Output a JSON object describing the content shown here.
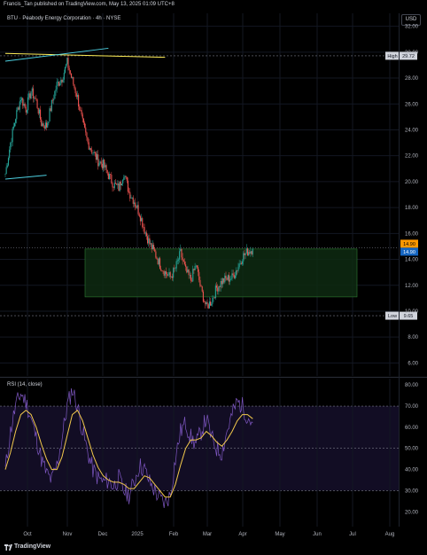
{
  "header": {
    "publisher_text": "Francis_Tan published on TradingView.com, May 13, 2025 01:09 UTC+8"
  },
  "footer": {
    "brand": "TradingView"
  },
  "currency_label": "USD",
  "colors": {
    "background": "#000000",
    "candle_up": "#26a69a",
    "candle_down": "#ef5350",
    "rsi_line": "#7e57c2",
    "rsi_ma": "#f2c94c",
    "cyan_line": "#4dd0e1",
    "yellow_line": "#ffee58",
    "zone_fill": "#0e2a12",
    "zone_border": "#2e7d32",
    "last_price_label": "#ff9800"
  },
  "chart_data": [
    {
      "type": "candlestick",
      "title": "BTU · Peabody Energy Corporation · 4h · NYSE",
      "x_ticks": [
        "Oct",
        "Nov",
        "Dec",
        "2025",
        "Feb",
        "Mar",
        "Apr",
        "May",
        "Jun",
        "Jul",
        "Aug"
      ],
      "y_ticks": [
        "6.00",
        "8.00",
        "10.00",
        "12.00",
        "14.00",
        "16.00",
        "18.00",
        "20.00",
        "22.00",
        "24.00",
        "26.00",
        "28.00",
        "30.00",
        "32.00"
      ],
      "ylim": [
        5,
        33
      ],
      "price_path": [
        [
          0,
          20.6
        ],
        [
          1,
          23
        ],
        [
          2,
          25
        ],
        [
          3,
          26.5
        ],
        [
          4,
          25.6
        ],
        [
          5,
          27
        ],
        [
          6,
          26.2
        ],
        [
          7,
          24.5
        ],
        [
          8,
          24.3
        ],
        [
          9,
          26
        ],
        [
          10,
          27.5
        ],
        [
          11,
          28
        ],
        [
          12,
          29.2
        ],
        [
          13,
          27.8
        ],
        [
          14,
          26.5
        ],
        [
          15,
          24.5
        ],
        [
          16,
          23
        ],
        [
          17,
          22.3
        ],
        [
          18,
          21.6
        ],
        [
          19,
          21.3
        ],
        [
          20,
          20.5
        ],
        [
          21,
          19.8
        ],
        [
          22,
          19.5
        ],
        [
          23,
          20.7
        ],
        [
          24,
          19.2
        ],
        [
          25,
          18.5
        ],
        [
          26,
          17.6
        ],
        [
          27,
          16.3
        ],
        [
          28,
          15.2
        ],
        [
          29,
          14.5
        ],
        [
          30,
          13.6
        ],
        [
          31,
          13
        ],
        [
          32,
          12.6
        ],
        [
          33,
          13.3
        ],
        [
          34,
          14.5
        ],
        [
          35,
          13.1
        ],
        [
          36,
          12.4
        ],
        [
          37,
          13.6
        ],
        [
          38,
          11.6
        ],
        [
          39,
          10.3
        ],
        [
          40,
          10.8
        ],
        [
          41,
          11.8
        ],
        [
          42,
          12.3
        ],
        [
          43,
          12.5
        ],
        [
          44,
          12.6
        ],
        [
          45,
          13.3
        ],
        [
          46,
          14.2
        ],
        [
          47,
          14.6
        ],
        [
          48,
          14.8
        ]
      ],
      "days_per_step": 4.33,
      "annotations": {
        "high": {
          "label": "High",
          "value": "29.72"
        },
        "low": {
          "label": "Low",
          "value": "9.65"
        },
        "last_price": "14.90",
        "last_price_2": "14.90"
      },
      "support_zone": {
        "from_date": "Nov",
        "to_date": "Jul",
        "low": 11.1,
        "high": 14.8
      },
      "trendlines": [
        {
          "color": "yellow",
          "points": [
            [
              0,
              29.9
            ],
            [
              31,
              29.6
            ]
          ]
        },
        {
          "color": "cyan",
          "points": [
            [
              0,
              29.3
            ],
            [
              20,
              30.3
            ]
          ]
        },
        {
          "color": "cyan",
          "points": [
            [
              0,
              20.2
            ],
            [
              8,
              20.5
            ]
          ]
        }
      ]
    },
    {
      "type": "line",
      "title": "RSI (14, close)",
      "y_ticks": [
        "20.00",
        "30.00",
        "40.00",
        "50.00",
        "60.00",
        "70.00",
        "80.00"
      ],
      "ylim": [
        13,
        83
      ],
      "overbought": 70,
      "oversold": 30,
      "middle": 50,
      "series": [
        {
          "values": [
            40,
            58,
            70,
            76,
            72,
            64,
            55,
            45,
            38,
            35,
            42,
            55,
            70,
            78,
            70,
            58,
            48,
            40,
            36,
            34,
            35,
            32,
            36,
            30,
            28,
            34,
            42,
            40,
            34,
            30,
            26,
            24,
            28,
            45,
            58,
            62,
            55,
            52,
            58,
            64,
            55,
            50,
            48,
            58,
            66,
            72,
            70,
            65,
            62
          ]
        },
        {
          "values": [
            40,
            48,
            58,
            66,
            68,
            66,
            60,
            52,
            45,
            40,
            40,
            46,
            56,
            66,
            68,
            63,
            55,
            47,
            41,
            37,
            35,
            34,
            34,
            33,
            31,
            31,
            34,
            37,
            36,
            33,
            30,
            27,
            27,
            33,
            42,
            50,
            54,
            54,
            55,
            58,
            56,
            53,
            51,
            54,
            58,
            63,
            66,
            66,
            64
          ]
        }
      ]
    }
  ]
}
